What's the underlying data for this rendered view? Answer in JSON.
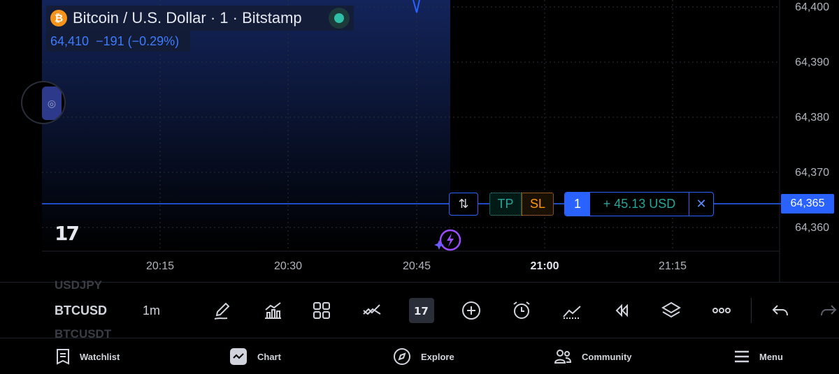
{
  "header": {
    "symbol_title": "Bitcoin / U.S. Dollar · 1 · Bitstamp",
    "logo_glyph": "₿",
    "last_price": "64,410",
    "change": "−191 (−0.29%)"
  },
  "price_axis": {
    "ticks": [
      "64,400",
      "64,390",
      "64,380",
      "64,370",
      "64,360"
    ],
    "current_price_label": "64,365"
  },
  "time_axis": {
    "ticks": [
      "20:15",
      "20:30",
      "20:45",
      "21:00",
      "21:15"
    ],
    "bold_tick": "21:00"
  },
  "position": {
    "swap_icon": "⇅",
    "tp_label": "TP",
    "sl_label": "SL",
    "quantity": "1",
    "pnl": "+ 45.13 USD",
    "close_icon": "✕"
  },
  "watermark": "17",
  "toolbar": {
    "prev_symbol": "USDJPY",
    "symbol": "BTCUSD",
    "next_symbol": "BTCUSDT",
    "interval": "1m"
  },
  "bottom_nav": [
    {
      "label": "Watchlist",
      "icon": "watchlist-icon"
    },
    {
      "label": "Chart",
      "icon": "chart-icon"
    },
    {
      "label": "Explore",
      "icon": "compass-icon"
    },
    {
      "label": "Community",
      "icon": "community-icon"
    },
    {
      "label": "Menu",
      "icon": "hamburger-icon"
    }
  ],
  "colors": {
    "accent": "#2962ff",
    "profit": "#26a69a",
    "stop_loss": "#ff9800",
    "btc": "#f7931a"
  }
}
